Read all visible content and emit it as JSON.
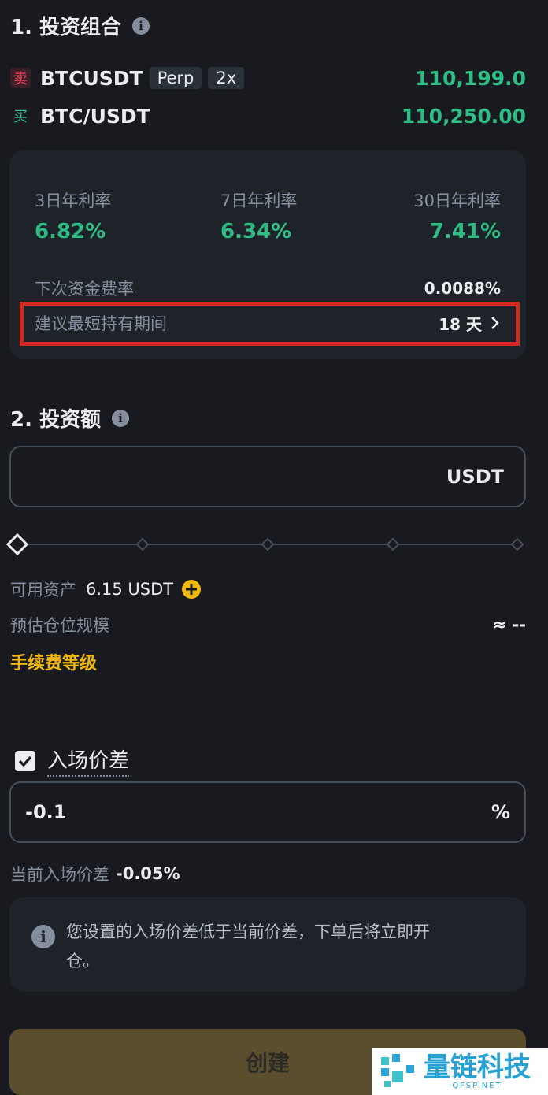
{
  "section1": {
    "title": "1. 投资组合",
    "info_icon": "info-icon"
  },
  "pairs": [
    {
      "side": "卖",
      "name": "BTCUSDT",
      "tags": [
        "Perp",
        "2x"
      ],
      "price": "110,199.0"
    },
    {
      "side": "买",
      "name": "BTC/USDT",
      "tags": [],
      "price": "110,250.00"
    }
  ],
  "rates": [
    {
      "label": "3日年利率",
      "value": "6.82%"
    },
    {
      "label": "7日年利率",
      "value": "6.34%"
    },
    {
      "label": "30日年利率",
      "value": "7.41%"
    }
  ],
  "next_funding": {
    "label": "下次资金费率",
    "value": "0.0088%"
  },
  "min_hold": {
    "label": "建议最短持有期间",
    "value": "18 天",
    "icon": "chevron-right-icon"
  },
  "section2": {
    "title": "2. 投资额",
    "info_icon": "info-icon"
  },
  "amount_input": {
    "value": "",
    "unit": "USDT"
  },
  "slider": {
    "value_fraction": 0,
    "nodes": 5
  },
  "available": {
    "label": "可用资产",
    "value": "6.15 USDT",
    "icon": "plus-circle-icon"
  },
  "est_position": {
    "label": "预估仓位规模",
    "value": "≈ --"
  },
  "fee_tier": {
    "label": "手续费等级"
  },
  "entry_spread": {
    "checkbox_label": "入场价差",
    "checked": true,
    "value": "-0.1",
    "unit": "%"
  },
  "current_spread": {
    "label": "当前入场价差",
    "value": "-0.05%"
  },
  "notice": {
    "text_line1": "您设置的入场价差低于当前价差，下单后将立即开",
    "text_line2": "仓。",
    "icon": "info-icon"
  },
  "create_button": {
    "label": "创建"
  },
  "watermark": {
    "cn": "量链科技",
    "en": "QFSP.NET"
  },
  "colors": {
    "background": "#181a20",
    "card": "#1e2329",
    "green": "#2ebd85",
    "red": "#f6465d",
    "yellow": "#f0b90b",
    "highlight_box": "#d12a1c",
    "button": "#5a4e2c"
  }
}
